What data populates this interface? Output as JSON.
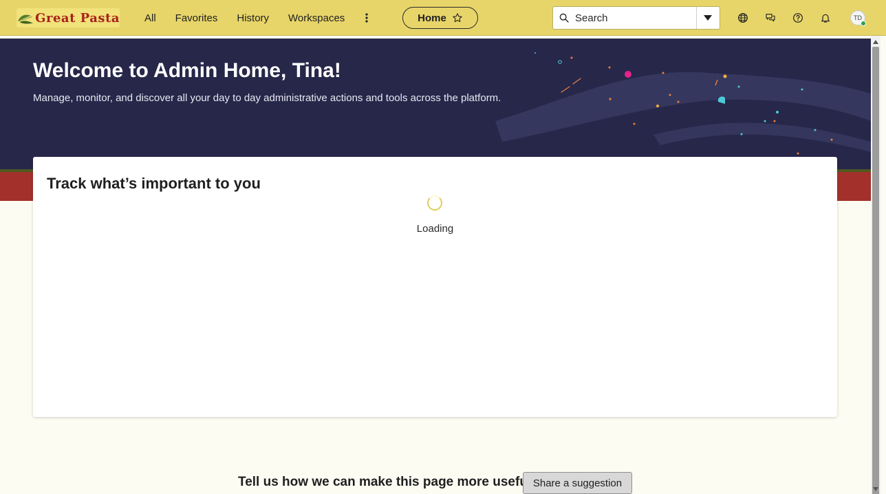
{
  "brand": {
    "logo_text": "Great Pasta"
  },
  "nav": {
    "links": [
      "All",
      "Favorites",
      "History",
      "Workspaces"
    ],
    "more_icon": "more-vertical-icon",
    "home_pill": {
      "label": "Home",
      "icon": "star-outline-icon"
    }
  },
  "search": {
    "placeholder": "Search",
    "icon": "search-icon",
    "dropdown_icon": "caret-down-icon"
  },
  "header_icons": [
    "globe-icon",
    "chat-icon",
    "help-icon",
    "bell-icon"
  ],
  "user": {
    "initials": "TD",
    "status": "online"
  },
  "hero": {
    "title": "Welcome to Admin Home, Tina!",
    "subtitle": "Manage, monitor, and discover all your day to day administrative actions and tools across the platform."
  },
  "card": {
    "title": "Track what’s important to you",
    "loading_text": "Loading"
  },
  "footer": {
    "prompt": "Tell us how we can make this page more useful",
    "button_label": "Share a suggestion"
  },
  "colors": {
    "header_bg": "#e7d56a",
    "hero_bg": "#27274a",
    "hero_strip": "#a3302b",
    "page_bg": "#fdfcf3",
    "brand_red": "#a8231a"
  }
}
